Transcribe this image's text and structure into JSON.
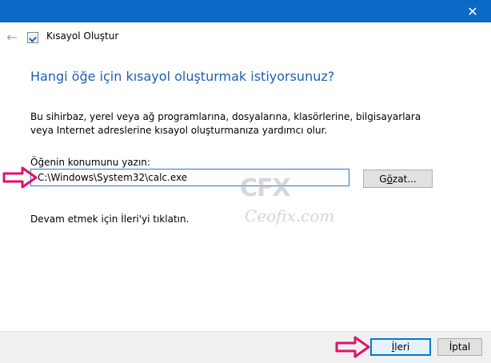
{
  "window": {
    "title": "Kısayol Oluştur",
    "close_glyph": "✕",
    "back_glyph": "←",
    "accent_color": "#0b6ac6"
  },
  "main": {
    "heading": "Hangi öğe için kısayol oluşturmak istiyorsunuz?",
    "description": "Bu sihirbaz, yerel veya ağ programlarına, dosyalarına, klasörlerine, bilgisayarlara veya Internet adreslerine kısayol oluşturmanıza yardımcı olur.",
    "location_label": "Öğenin konumunu yazın:",
    "location_value": "C:\\Windows\\System32\\calc.exe",
    "browse_button": {
      "pre": "G",
      "underlined": "ö",
      "post": "zat..."
    },
    "next_hint": "Devam etmek için İleri'yi tıklatın."
  },
  "footer": {
    "next_button": {
      "underlined": "İ",
      "post": "leri"
    },
    "cancel_button": "İptal"
  },
  "watermark": {
    "logo": "CFX",
    "text": "Ceofix.com"
  },
  "annotation": {
    "arrow_color": "#e0116a",
    "arrow_icon": "hollow-right-arrow"
  }
}
